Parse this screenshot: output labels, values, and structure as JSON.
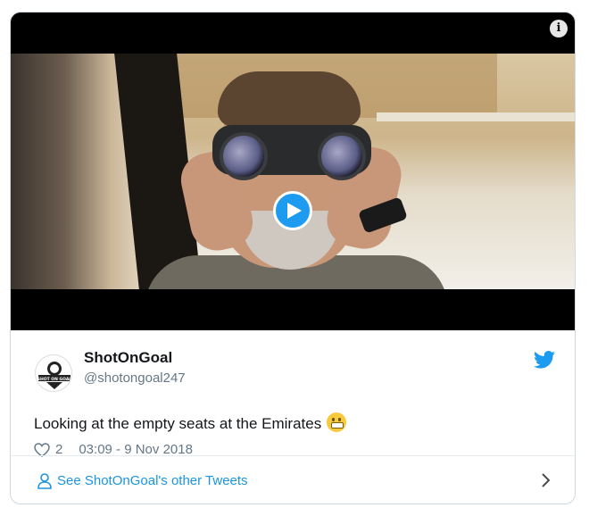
{
  "tweet": {
    "name": "ShotOnGoal",
    "handle": "@shotongoal247",
    "text": "Looking at the empty seats at the Emirates",
    "likes": "2",
    "timestamp": "03:09 - 9 Nov 2018",
    "avatar_text": "SHOT ON GOAL"
  },
  "footer": {
    "link_label": "See ShotOnGoal's other Tweets"
  },
  "colors": {
    "accent": "#1d9bf0",
    "link": "#1b95e0",
    "muted": "#657786",
    "text": "#14171a"
  },
  "icons": [
    "info-icon",
    "play-icon",
    "twitter-bird-icon",
    "heart-icon",
    "grimacing-emoji-icon",
    "user-icon",
    "chevron-right-icon"
  ]
}
